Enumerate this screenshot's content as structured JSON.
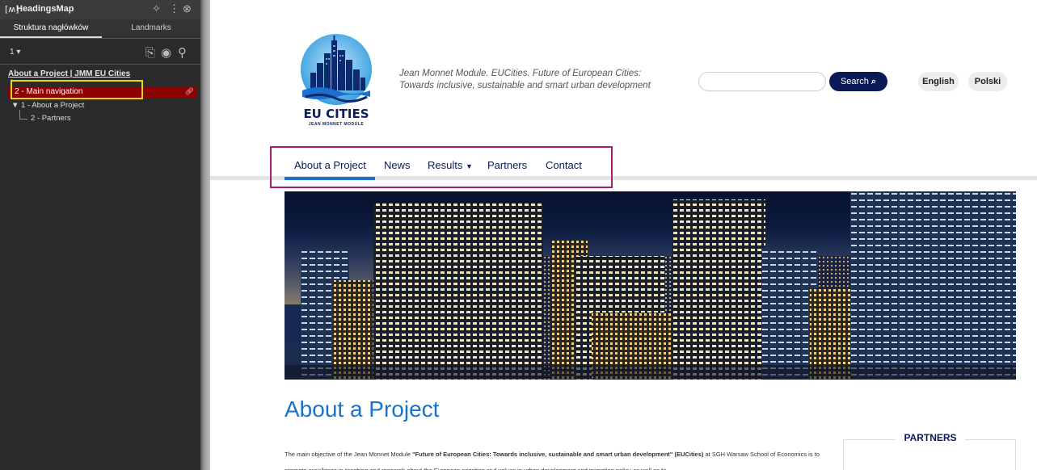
{
  "headingsmap": {
    "title": "HeadingsMap",
    "tabs": [
      "Struktura nagłówków",
      "Landmarks"
    ],
    "level_selector": "1",
    "doc_title": "About a Project | JMM EU Cities",
    "rows": {
      "main_nav": "2 - Main navigation",
      "about": "1 - About a Project",
      "partners": "2 - Partners"
    }
  },
  "site": {
    "logo_text": "EU CITIES",
    "logo_subtext": "JEAN MONNET MODULE",
    "tagline": "Jean Monnet Module. EUCities. Future of European Cities: Towards inclusive, sustainable and smart urban development",
    "search_button": "Search",
    "lang_en": "English",
    "lang_pl": "Polski",
    "nav": [
      "About a Project",
      "News",
      "Results",
      "Partners",
      "Contact"
    ],
    "heading": "About a Project",
    "body_prefix": "The main objective of the Jean Monnet Module ",
    "body_bold": "\"Future of European Cities: Towards inclusive, sustainable and smart urban development\" (EUCities)",
    "body_suffix": " at SGH Warsaw School of Economics is to promote excellence in teaching and research about the European priorities and values in urban development and migration policy as well as to",
    "partners_title": "PARTNERS"
  },
  "colors": {
    "brand_navy": "#0b1a56",
    "accent_blue": "#1a73c8",
    "highlight_magenta": "#a4206b",
    "highlight_yellow": "#f1d40c",
    "selected_row": "#8b0000"
  }
}
